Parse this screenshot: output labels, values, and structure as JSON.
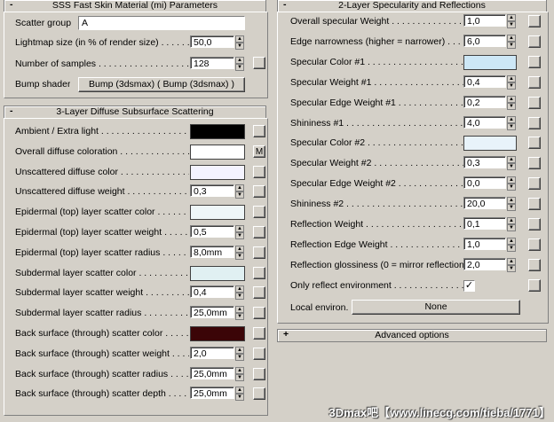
{
  "left": {
    "sss_rollout": {
      "sign": "-",
      "title": "SSS Fast Skin Material (mi) Parameters"
    },
    "scatter_group": {
      "label": "Scatter group",
      "value": "A"
    },
    "lightmap": {
      "label": "Lightmap size (in % of render size) . . . . . . . .",
      "value": "50,0"
    },
    "samples": {
      "label": "Number of samples . . . . . . . . . . . . . . . . . . . .",
      "value": "128"
    },
    "bump": {
      "label": "Bump shader",
      "value": "Bump (3dsmax)  ( Bump (3dsmax) )"
    },
    "diffuse_rollout": {
      "sign": "-",
      "title": "3-Layer Diffuse Subsurface Scattering"
    },
    "rows": [
      {
        "label": "Ambient / Extra light . . . . . . . . . . . . . . . . . . .",
        "type": "color",
        "color": "#000000",
        "name": "ambient"
      },
      {
        "label": "Overall diffuse coloration . . . . . . . . . . . . . . .",
        "type": "color",
        "color": "#ffffff",
        "name": "overall-diffuse",
        "map": "M"
      },
      {
        "label": "Unscattered diffuse color . . . . . . . . . . . . . . . .",
        "type": "color",
        "color": "#f4f3ff",
        "name": "unscattered-color"
      },
      {
        "label": "Unscattered diffuse weight . . . . . . . . . . . . . . .",
        "type": "spinner",
        "value": "0,3",
        "name": "unscattered-weight"
      },
      {
        "label": "Epidermal (top) layer scatter color . . . . . . . . .",
        "type": "color",
        "color": "#eef6f8",
        "name": "epidermal-color"
      },
      {
        "label": "Epidermal (top) layer scatter weight . . . . . . . .",
        "type": "spinner",
        "value": "0,5",
        "name": "epidermal-weight"
      },
      {
        "label": "Epidermal (top) layer scatter radius . . . . . . . .",
        "type": "spinner",
        "value": "8,0mm",
        "name": "epidermal-radius"
      },
      {
        "label": "Subdermal layer scatter color . . . . . . . . . . . . .",
        "type": "color",
        "color": "#e0f0f2",
        "name": "subdermal-color"
      },
      {
        "label": "Subdermal layer scatter weight . . . . . . . . . . . .",
        "type": "spinner",
        "value": "0,4",
        "name": "subdermal-weight"
      },
      {
        "label": "Subdermal layer scatter radius . . . . . . . . . . . .",
        "type": "spinner",
        "value": "25,0mm",
        "name": "subdermal-radius"
      },
      {
        "label": "Back surface (through) scatter color . . . . . . . .",
        "type": "color",
        "color": "#3b0507",
        "name": "back-color"
      },
      {
        "label": "Back surface (through) scatter weight . . . . . . .",
        "type": "spinner",
        "value": "2,0",
        "name": "back-weight"
      },
      {
        "label": "Back surface (through) scatter radius . . . . . . .",
        "type": "spinner",
        "value": "25,0mm",
        "name": "back-radius"
      },
      {
        "label": "Back surface (through) scatter depth . . . . . . . .",
        "type": "spinner",
        "value": "25,0mm",
        "name": "back-depth"
      }
    ]
  },
  "right": {
    "spec_rollout": {
      "sign": "-",
      "title": "2-Layer Specularity and Reflections"
    },
    "rows": [
      {
        "label": "Overall specular Weight . . . . . . . . . . . . . . . .",
        "type": "spinner",
        "value": "1,0",
        "name": "overall-spec-weight"
      },
      {
        "label": "Edge narrowness (higher = narrower) . . . . . . .",
        "type": "spinner",
        "value": "6,0",
        "name": "edge-narrowness"
      },
      {
        "label": "Specular Color #1 . . . . . . . . . . . . . . . . . . . . .",
        "type": "color",
        "color": "#cde7f6",
        "name": "spec-color-1"
      },
      {
        "label": "Specular Weight #1 . . . . . . . . . . . . . . . . . . . .",
        "type": "spinner",
        "value": "0,4",
        "name": "spec-weight-1"
      },
      {
        "label": "Specular Edge Weight #1 . . . . . . . . . . . . . . . .",
        "type": "spinner",
        "value": "0,2",
        "name": "spec-edge-weight-1"
      },
      {
        "label": "Shininess #1 . . . . . . . . . . . . . . . . . . . . . . . .",
        "type": "spinner",
        "value": "4,0",
        "name": "shininess-1"
      },
      {
        "label": "Specular Color #2 . . . . . . . . . . . . . . . . . . . . .",
        "type": "color",
        "color": "#e8f3fa",
        "name": "spec-color-2"
      },
      {
        "label": "Specular Weight #2 . . . . . . . . . . . . . . . . . . . .",
        "type": "spinner",
        "value": "0,3",
        "name": "spec-weight-2"
      },
      {
        "label": "Specular Edge Weight #2 . . . . . . . . . . . . . . . .",
        "type": "spinner",
        "value": "0,0",
        "name": "spec-edge-weight-2"
      },
      {
        "label": "Shininess #2 . . . . . . . . . . . . . . . . . . . . . . . .",
        "type": "spinner",
        "value": "20,0",
        "name": "shininess-2"
      },
      {
        "label": "Reflection Weight . . . . . . . . . . . . . . . . . . . . .",
        "type": "spinner",
        "value": "0,1",
        "name": "reflection-weight"
      },
      {
        "label": "Reflection Edge Weight . . . . . . . . . . . . . . . . .",
        "type": "spinner",
        "value": "1,0",
        "name": "reflection-edge-weight"
      },
      {
        "label": "Reflection glossiness (0 = mirror reflection) . .",
        "type": "spinner",
        "value": "2,0",
        "name": "reflection-glossiness"
      },
      {
        "label": "Only reflect environment . . . . . . . . . . . . . . . .",
        "type": "check",
        "value": "✓",
        "name": "only-reflect-env"
      }
    ],
    "local_environ": {
      "label": "Local environ.",
      "value": "None"
    },
    "advanced_rollout": {
      "sign": "+",
      "title": "Advanced options"
    }
  },
  "watermark": "3Dmax吧【www.linecg.com/tieba/1771】"
}
